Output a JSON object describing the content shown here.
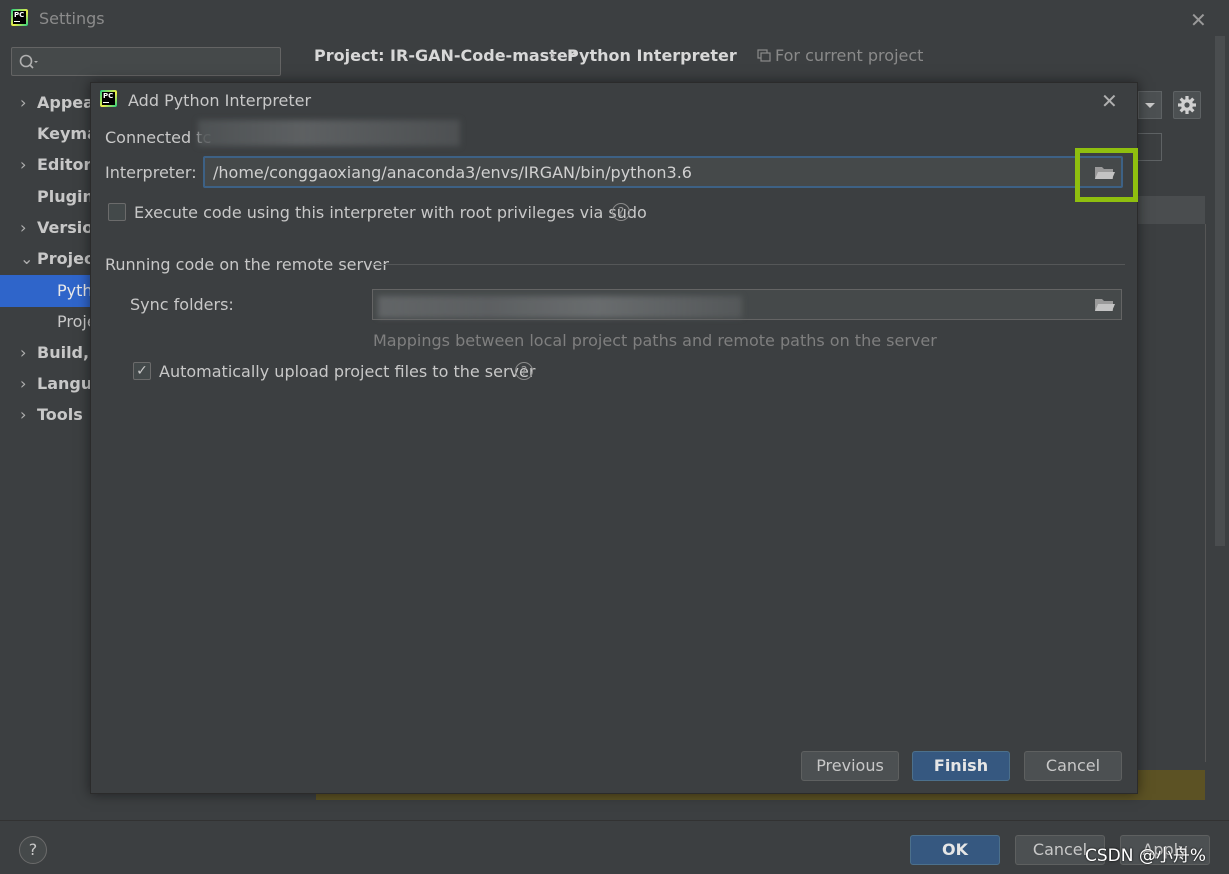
{
  "window": {
    "title": "Settings",
    "close_glyph": "✕"
  },
  "search": {
    "placeholder": ""
  },
  "sidebar": {
    "items": [
      {
        "label": "Appear",
        "arrow": "›"
      },
      {
        "label": "Keyma",
        "arrow": ""
      },
      {
        "label": "Editor",
        "arrow": "›"
      },
      {
        "label": "Plugins",
        "arrow": ""
      },
      {
        "label": "Versior",
        "arrow": "›"
      },
      {
        "label": "Project",
        "arrow": "⌄"
      },
      {
        "label": "Build, E",
        "arrow": "›"
      },
      {
        "label": "Langua",
        "arrow": "›"
      },
      {
        "label": "Tools",
        "arrow": "›"
      }
    ],
    "subitems": [
      {
        "label": "Pyth",
        "selected": true
      },
      {
        "label": "Proje",
        "selected": false
      }
    ]
  },
  "breadcrumb": {
    "project": "Project: IR-GAN-Code-master",
    "separator": "›",
    "page": "Python Interpreter"
  },
  "scope": {
    "label": "For current project"
  },
  "dialog": {
    "title": "Add Python Interpreter",
    "connected_label": "Connected tc",
    "interpreter_label": "Interpreter:",
    "interpreter_value": "/home/conggaoxiang/anaconda3/envs/IRGAN/bin/python3.6",
    "sudo_label": "Execute code using this interpreter with root privileges via sudo",
    "sudo_checked": false,
    "remote_section_title": "Running code on the remote server",
    "sync_label": "Sync folders:",
    "sync_hint": "Mappings between local project paths and remote paths on the server",
    "upload_label": "Automatically upload project files to the server",
    "upload_checked": true,
    "buttons": {
      "previous": "Previous",
      "finish": "Finish",
      "cancel": "Cancel"
    }
  },
  "footer": {
    "help": "?",
    "ok": "OK",
    "cancel": "Cancel",
    "apply": "Apply"
  },
  "watermark": "CSDN @小舟%",
  "colors": {
    "accent": "#2f65ca",
    "primary_button": "#365880",
    "highlight": "#8fbf0f",
    "background": "#3c3f41"
  },
  "icons": [
    "pycharm-logo-icon",
    "search-icon",
    "gear-icon",
    "folder-icon",
    "close-icon",
    "help-icon",
    "chevron-down-icon"
  ]
}
